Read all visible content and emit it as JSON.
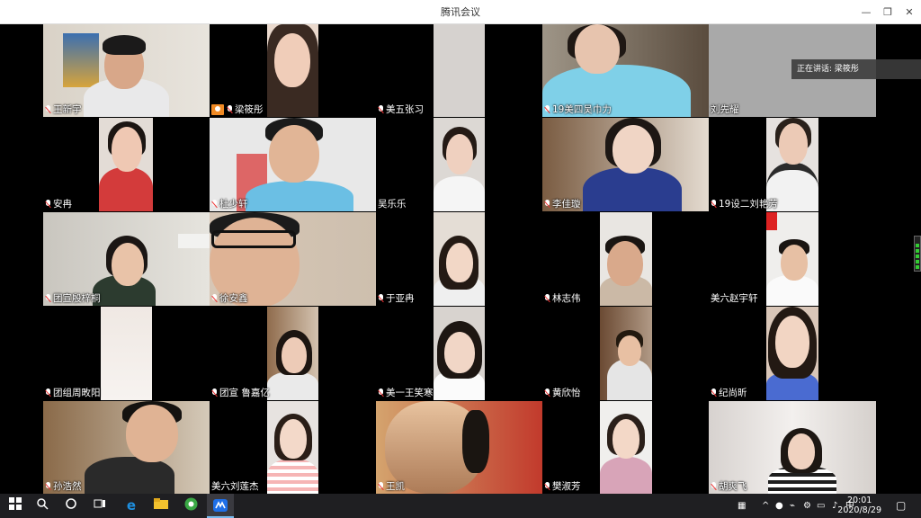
{
  "window": {
    "title": "腾讯会议",
    "controls": [
      "—",
      "❐",
      "✕"
    ]
  },
  "speaker_notice": "正在讲话: 梁筱彤",
  "participants": [
    {
      "name": "王新宇"
    },
    {
      "name": "梁筱彤"
    },
    {
      "name": "美五张习"
    },
    {
      "name": "19美四吴巾力"
    },
    {
      "name": "刘先耀"
    },
    {
      "name": "安冉"
    },
    {
      "name": "杜少轩"
    },
    {
      "name": "吴乐乐"
    },
    {
      "name": "李佳璇"
    },
    {
      "name": "19设二刘艳芳"
    },
    {
      "name": "团宣殷梓桐"
    },
    {
      "name": "徐安鑫"
    },
    {
      "name": "于亚冉"
    },
    {
      "name": "林志伟"
    },
    {
      "name": "美六赵宇轩"
    },
    {
      "name": "团组周畋阳"
    },
    {
      "name": "团宣 鲁嘉亿"
    },
    {
      "name": "美一王笑寒"
    },
    {
      "name": "黄欣怡"
    },
    {
      "name": "纪尚昕"
    },
    {
      "name": "孙浩然"
    },
    {
      "name": "美六刘莲杰"
    },
    {
      "name": "王凯"
    },
    {
      "name": "樊淑芳"
    },
    {
      "name": "胡爽飞"
    }
  ],
  "taskbar": {
    "start_icon": "windows-logo-icon",
    "clock_time": "20:01",
    "clock_date": "2020/8/29"
  }
}
